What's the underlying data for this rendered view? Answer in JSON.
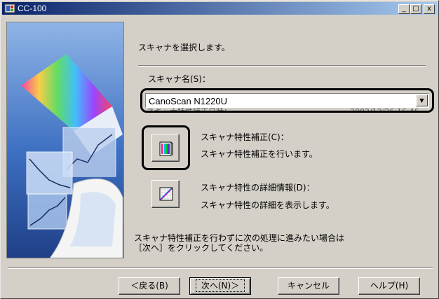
{
  "window": {
    "title": "CC-100",
    "minimize": "_",
    "maximize": "□",
    "close": "x"
  },
  "main": {
    "intro": "スキャナを選択します。",
    "scanner_name_label": "スキャナ名(S)：",
    "scanner_selected": "CanoScan N1220U",
    "hidden_date_label": "スキャナ特性補正日時：",
    "hidden_date_value": "2002/12/26 16:46",
    "calibration": {
      "title": "スキャナ特性補正(C)：",
      "desc": "スキャナ特性補正を行います。"
    },
    "details": {
      "title": "スキャナ特性の詳細情報(D)：",
      "desc": "スキャナ特性の詳細を表示します。"
    },
    "note_line1": "スキャナ特性補正を行わずに次の処理に進みたい場合は",
    "note_line2": "［次へ］をクリックしてください。"
  },
  "buttons": {
    "back": "＜戻る(B)",
    "next": "次へ(N)＞",
    "cancel": "キャンセル",
    "help": "ヘルプ(H)"
  }
}
